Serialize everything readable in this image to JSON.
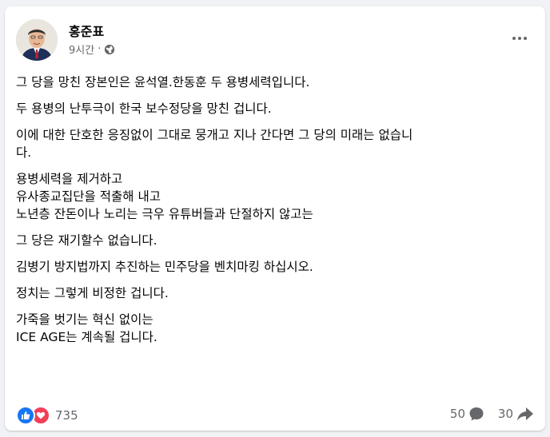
{
  "post": {
    "author": "홍준표",
    "time": "9시간",
    "separator": "·",
    "privacy_icon": "globe-icon",
    "more_icon": "more-options-icon",
    "paragraphs": [
      [
        "그 당을 망친 장본인은 윤석열.한동훈 두 용병세력입니다."
      ],
      [
        "두 용병의 난투극이 한국 보수정당을 망친 겁니다."
      ],
      [
        "이에 대한 단호한 응징없이 그대로 뭉개고 지나 간다면 그 당의 미래는 없습니",
        "다."
      ],
      [
        "용병세력을 제거하고",
        "유사종교집단을 적출해 내고",
        "노년층 잔돈이나 노리는 극우 유튜버들과 단절하지 않고는"
      ],
      [
        "그 당은 재기할수 없습니다."
      ],
      [
        "김병기 방지법까지 추진하는 민주당을 벤치마킹 하십시오."
      ],
      [
        "정치는 그렇게 비정한 겁니다."
      ],
      [
        "가죽을 벗기는 혁신 없이는",
        "ICE AGE는 계속될 겁니다."
      ]
    ]
  },
  "stats": {
    "reaction_icons": [
      "like-icon",
      "love-icon"
    ],
    "reaction_count": "735",
    "comment_count": "50",
    "share_count": "30"
  },
  "colors": {
    "like": "#1877f2",
    "love": "#f33e58",
    "secondary_text": "#65676b",
    "background": "#f0f2f5"
  }
}
